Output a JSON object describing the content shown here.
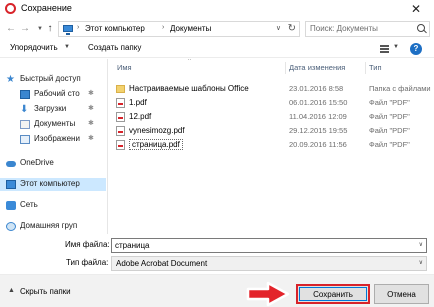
{
  "window": {
    "title": "Сохранение"
  },
  "address": {
    "segments": [
      "Этот компьютер",
      "Документы"
    ]
  },
  "search": {
    "placeholder": "Поиск: Документы"
  },
  "toolbar": {
    "organize_label": "Упорядочить",
    "new_folder_label": "Создать папку"
  },
  "sidebar": {
    "items": [
      {
        "label": "Быстрый доступ",
        "icon": "star-icon"
      },
      {
        "label": "Рабочий сто",
        "icon": "desktop-icon",
        "pinned": true
      },
      {
        "label": "Загрузки",
        "icon": "download-icon",
        "pinned": true
      },
      {
        "label": "Документы",
        "icon": "documents-icon",
        "pinned": true
      },
      {
        "label": "Изображени",
        "icon": "pictures-icon",
        "pinned": true
      },
      {
        "label": "OneDrive",
        "icon": "onedrive-icon"
      },
      {
        "label": "Этот компьютер",
        "icon": "computer-icon",
        "selected": true
      },
      {
        "label": "Сеть",
        "icon": "network-icon"
      },
      {
        "label": "Домашняя груп",
        "icon": "homegroup-icon"
      }
    ]
  },
  "columns": {
    "name": "Имя",
    "date": "Дата изменения",
    "type": "Тип"
  },
  "files": [
    {
      "name": "Настраиваемые шаблоны Office",
      "date": "23.01.2016 8:58",
      "type": "Папка с файлами",
      "kind": "folder"
    },
    {
      "name": "1.pdf",
      "date": "06.01.2016 15:50",
      "type": "Файл \"PDF\"",
      "kind": "pdf"
    },
    {
      "name": "12.pdf",
      "date": "11.04.2016 12:09",
      "type": "Файл \"PDF\"",
      "kind": "pdf"
    },
    {
      "name": "vynesimozg.pdf",
      "date": "29.12.2015 19:55",
      "type": "Файл \"PDF\"",
      "kind": "pdf"
    },
    {
      "name": "страница.pdf",
      "date": "20.09.2016 11:56",
      "type": "Файл \"PDF\"",
      "kind": "pdf",
      "focused": true
    }
  ],
  "form": {
    "filename_label": "Имя файла:",
    "filename_value": "страница",
    "filetype_label": "Тип файла:",
    "filetype_value": "Adobe Acrobat Document"
  },
  "footer": {
    "hide_folders_label": "Скрыть папки",
    "save_label": "Сохранить",
    "cancel_label": "Отмена"
  },
  "colors": {
    "accent": "#0078d7",
    "highlight": "#d8232a",
    "selection": "#cce8ff"
  }
}
